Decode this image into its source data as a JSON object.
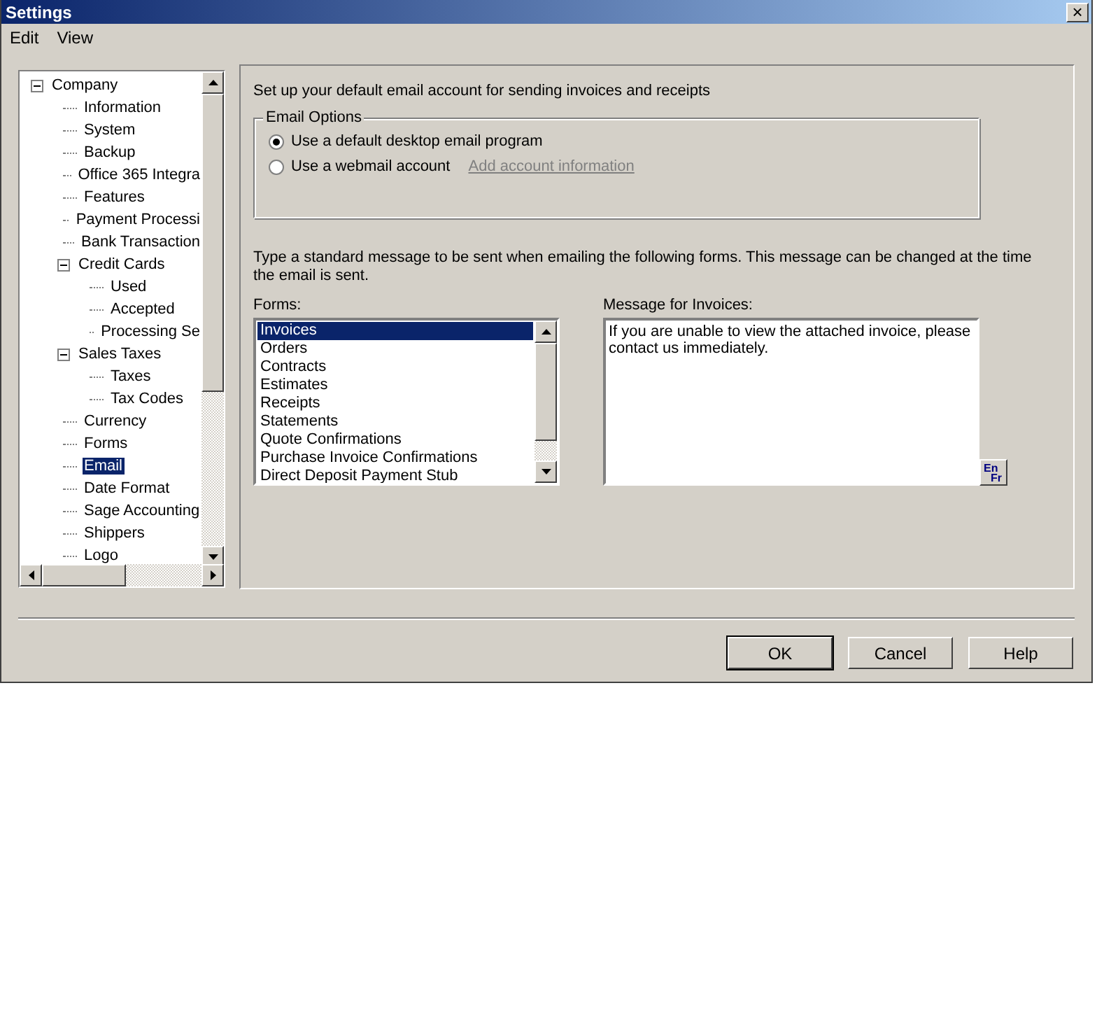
{
  "window": {
    "title": "Settings",
    "close": "×"
  },
  "menu": [
    "Edit",
    "View"
  ],
  "tree": [
    {
      "label": "Company",
      "selected": false,
      "expanded": true,
      "children": [
        {
          "label": "Information",
          "selected": false
        },
        {
          "label": "System",
          "selected": false
        },
        {
          "label": "Backup",
          "selected": false
        },
        {
          "label": "Office 365 Integra",
          "selected": false
        },
        {
          "label": "Features",
          "selected": false
        },
        {
          "label": "Payment Processi",
          "selected": false
        },
        {
          "label": "Bank Transaction",
          "selected": false
        },
        {
          "label": "Credit Cards",
          "selected": false,
          "expanded": true,
          "children": [
            {
              "label": "Used",
              "selected": false
            },
            {
              "label": "Accepted",
              "selected": false
            },
            {
              "label": "Processing Se",
              "selected": false
            }
          ]
        },
        {
          "label": "Sales Taxes",
          "selected": false,
          "expanded": true,
          "children": [
            {
              "label": "Taxes",
              "selected": false
            },
            {
              "label": "Tax Codes",
              "selected": false
            }
          ]
        },
        {
          "label": "Currency",
          "selected": false
        },
        {
          "label": "Forms",
          "selected": false
        },
        {
          "label": "Email",
          "selected": true
        },
        {
          "label": "Date Format",
          "selected": false
        },
        {
          "label": "Sage Accounting",
          "selected": false
        },
        {
          "label": "Shippers",
          "selected": false
        },
        {
          "label": "Logo",
          "selected": false
        }
      ]
    }
  ],
  "intro": "Set up your default email account for sending invoices and receipts",
  "email_options": {
    "legend": "Email Options",
    "options": [
      {
        "label": "Use a default desktop email program",
        "selected": true
      },
      {
        "label": "Use a webmail account",
        "selected": false
      }
    ],
    "link": {
      "label": "Add account information",
      "disabled": true
    }
  },
  "instructions": "Type a standard message to be sent when emailing the following forms. This message can be changed at the time the email is sent.",
  "forms": {
    "label": "Forms:",
    "items": [
      {
        "label": "Invoices",
        "selected": true
      },
      {
        "label": "Orders",
        "selected": false
      },
      {
        "label": "Contracts",
        "selected": false
      },
      {
        "label": "Estimates",
        "selected": false
      },
      {
        "label": "Receipts",
        "selected": false
      },
      {
        "label": "Statements",
        "selected": false
      },
      {
        "label": "Quote Confirmations",
        "selected": false
      },
      {
        "label": "Purchase Invoice Confirmations",
        "selected": false
      },
      {
        "label": "Direct Deposit Payment Stub",
        "selected": false
      }
    ]
  },
  "message": {
    "label": "Message for Invoices:",
    "value": "If you are unable to view the attached invoice, please contact us immediately."
  },
  "language_button": {
    "top": "En",
    "bottom": "Fr"
  },
  "buttons": [
    {
      "label": "OK",
      "default": true
    },
    {
      "label": "Cancel",
      "default": false
    },
    {
      "label": "Help",
      "default": false
    }
  ]
}
